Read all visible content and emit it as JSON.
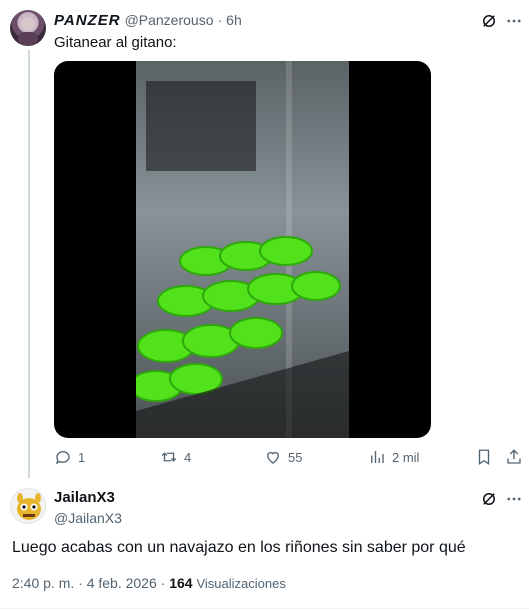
{
  "tweet1": {
    "display_name": "PANZER",
    "handle": "@Panzerouso",
    "separator": "·",
    "time": "6h",
    "text": "Gitanear al gitano:",
    "actions": {
      "replies": "1",
      "retweets": "4",
      "likes": "55",
      "views": "2 mil"
    }
  },
  "tweet2": {
    "display_name": "JailanX3",
    "handle": "@JailanX3",
    "text": "Luego acabas con un navajazo en los riñones sin saber por qué",
    "timestamp": "2:40 p. m. · 4 feb. 2026 ·",
    "views_count": "164",
    "views_label": "Visualizaciones"
  },
  "colors": {
    "text": "#0f1419",
    "muted": "#536471",
    "thread_line": "#cfd9de",
    "green": "#52e21b"
  },
  "icons": [
    "grok-icon",
    "more-icon",
    "reply-icon",
    "retweet-icon",
    "like-icon",
    "views-icon",
    "bookmark-icon",
    "share-icon"
  ]
}
